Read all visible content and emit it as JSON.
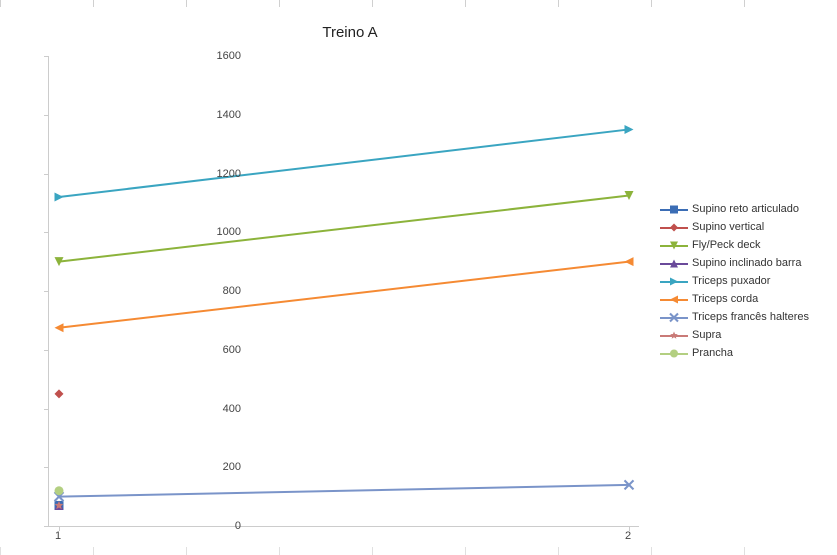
{
  "chart_data": {
    "type": "line",
    "title": "Treino A",
    "xlabel": "",
    "ylabel": "",
    "ylim": [
      0,
      1600
    ],
    "x": [
      1,
      2
    ],
    "yticks": [
      0,
      200,
      400,
      600,
      800,
      1000,
      1200,
      1400,
      1600
    ],
    "xticks": [
      1,
      2
    ],
    "series": [
      {
        "name": "Supino reto articulado",
        "values": [
          70,
          null
        ],
        "color": "#3b6db5",
        "marker": "square"
      },
      {
        "name": "Supino vertical",
        "values": [
          450,
          null
        ],
        "color": "#c0504d",
        "marker": "diamond"
      },
      {
        "name": "Fly/Peck deck",
        "values": [
          900,
          1125
        ],
        "color": "#8cb33b",
        "marker": "triangle-down"
      },
      {
        "name": "Supino inclinado barra",
        "values": [
          70,
          null
        ],
        "color": "#6a4a9a",
        "marker": "triangle-up"
      },
      {
        "name": "Triceps puxador",
        "values": [
          1120,
          1350
        ],
        "color": "#3aa5c1",
        "marker": "triangle-right"
      },
      {
        "name": "Triceps corda",
        "values": [
          675,
          900
        ],
        "color": "#f58a33",
        "marker": "triangle-left"
      },
      {
        "name": "Triceps francês halteres",
        "values": [
          100,
          140
        ],
        "color": "#7a94c9",
        "marker": "x"
      },
      {
        "name": "Supra",
        "values": [
          70,
          null
        ],
        "color": "#c97a77",
        "marker": "star"
      },
      {
        "name": "Prancha",
        "values": [
          120,
          null
        ],
        "color": "#b3cf81",
        "marker": "circle"
      }
    ]
  }
}
